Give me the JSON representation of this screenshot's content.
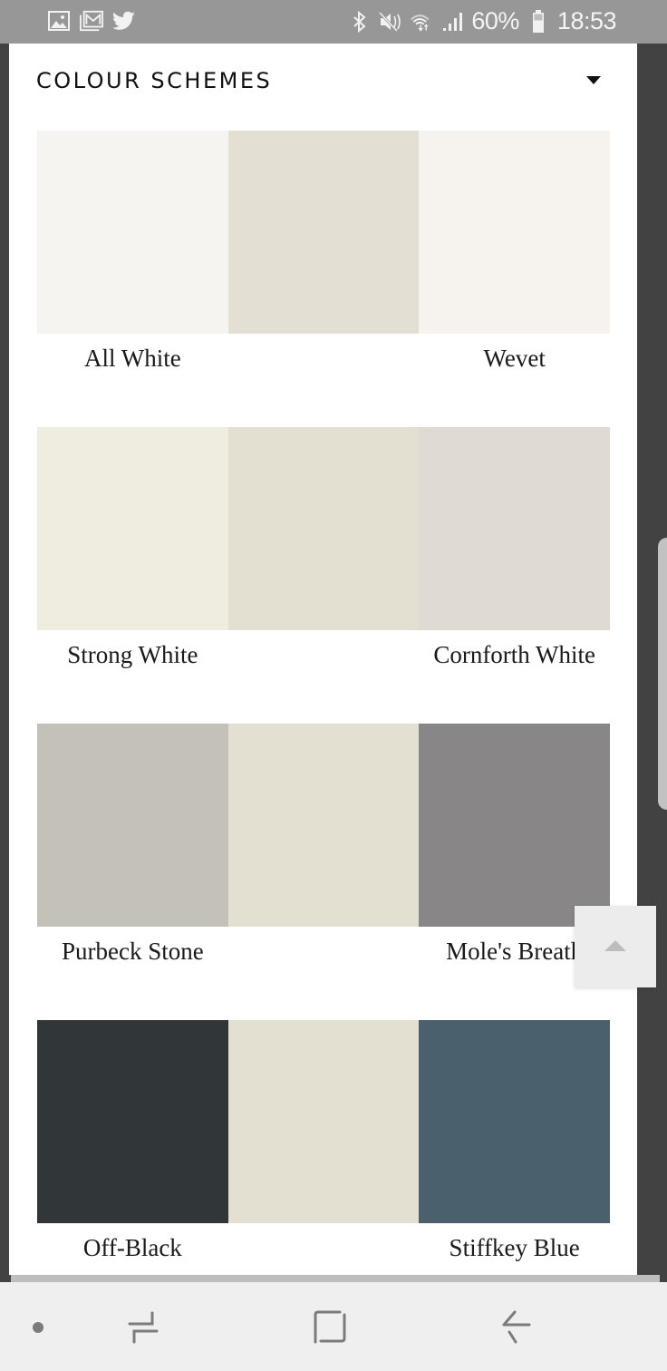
{
  "status_bar": {
    "left_icons": [
      "gallery-icon",
      "gmail-icon",
      "twitter-icon"
    ],
    "right_icons": [
      "bluetooth-icon",
      "mute-icon",
      "wifi-icon",
      "signal-icon"
    ],
    "battery_percent": "60%",
    "time": "18:53"
  },
  "section": {
    "title": "COLOUR SCHEMES",
    "dropdown_icon": "caret-down-icon"
  },
  "schemes": [
    {
      "colors": [
        "#f6f4f0",
        "#e3dfd2",
        "#f6f3ee"
      ],
      "labels": [
        "All White",
        "",
        "Wevet"
      ]
    },
    {
      "colors": [
        "#efece0",
        "#e3dfd1",
        "#dfdbd4"
      ],
      "labels": [
        "Strong White",
        "",
        "Cornforth White"
      ]
    },
    {
      "colors": [
        "#c4c1b9",
        "#e3e0d2",
        "#888687"
      ],
      "labels": [
        "Purbeck Stone",
        "",
        "Mole's Breath"
      ]
    },
    {
      "colors": [
        "#313639",
        "#e3e0d2",
        "#4a606d"
      ],
      "labels": [
        "Off-Black",
        "",
        "Stiffkey Blue"
      ]
    }
  ],
  "scroll_top_button": {
    "icon": "arrow-up-icon"
  },
  "nav_bar": {
    "items": [
      "dot-icon",
      "recent-apps-icon",
      "home-icon",
      "back-icon"
    ]
  }
}
